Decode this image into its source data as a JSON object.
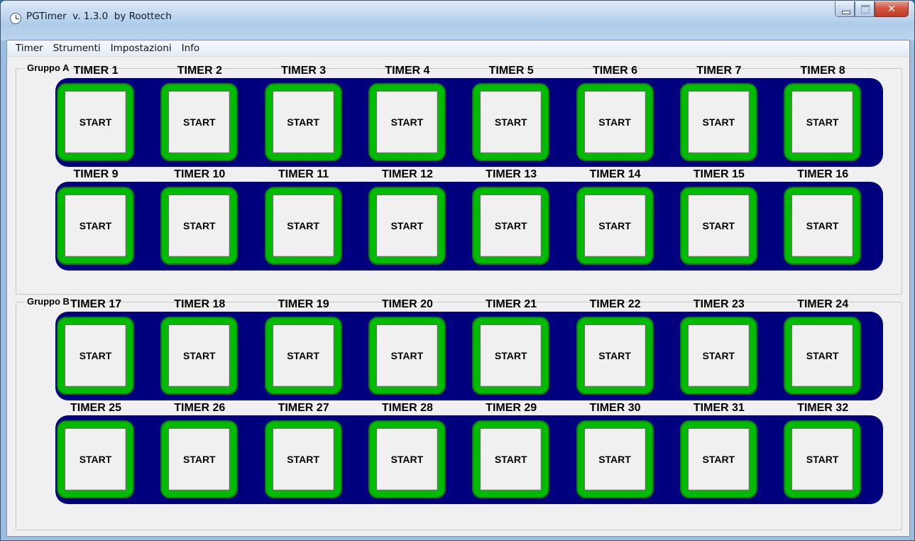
{
  "window": {
    "title": "PGTimer  v. 1.3.0  by Roottech"
  },
  "menu": {
    "items": [
      "Timer",
      "Strumenti",
      "Impostazioni",
      "Info"
    ]
  },
  "groups": [
    {
      "legend": "Gruppo A"
    },
    {
      "legend": "Gruppo B"
    }
  ],
  "timers": [
    {
      "label": "TIMER  1",
      "button": "START"
    },
    {
      "label": "TIMER  2",
      "button": "START"
    },
    {
      "label": "TIMER  3",
      "button": "START"
    },
    {
      "label": "TIMER  4",
      "button": "START"
    },
    {
      "label": "TIMER  5",
      "button": "START"
    },
    {
      "label": "TIMER  6",
      "button": "START"
    },
    {
      "label": "TIMER  7",
      "button": "START"
    },
    {
      "label": "TIMER  8",
      "button": "START"
    },
    {
      "label": "TIMER  9",
      "button": "START"
    },
    {
      "label": "TIMER 10",
      "button": "START"
    },
    {
      "label": "TIMER 11",
      "button": "START"
    },
    {
      "label": "TIMER 12",
      "button": "START"
    },
    {
      "label": "TIMER 13",
      "button": "START"
    },
    {
      "label": "TIMER 14",
      "button": "START"
    },
    {
      "label": "TIMER 15",
      "button": "START"
    },
    {
      "label": "TIMER 16",
      "button": "START"
    },
    {
      "label": "TIMER 17",
      "button": "START"
    },
    {
      "label": "TIMER 18",
      "button": "START"
    },
    {
      "label": "TIMER 19",
      "button": "START"
    },
    {
      "label": "TIMER 20",
      "button": "START"
    },
    {
      "label": "TIMER 21",
      "button": "START"
    },
    {
      "label": "TIMER 22",
      "button": "START"
    },
    {
      "label": "TIMER 23",
      "button": "START"
    },
    {
      "label": "TIMER 24",
      "button": "START"
    },
    {
      "label": "TIMER 25",
      "button": "START"
    },
    {
      "label": "TIMER 26",
      "button": "START"
    },
    {
      "label": "TIMER 27",
      "button": "START"
    },
    {
      "label": "TIMER 28",
      "button": "START"
    },
    {
      "label": "TIMER 29",
      "button": "START"
    },
    {
      "label": "TIMER 30",
      "button": "START"
    },
    {
      "label": "TIMER 31",
      "button": "START"
    },
    {
      "label": "TIMER 32",
      "button": "START"
    }
  ],
  "colors": {
    "panel": "#00007f",
    "timer_frame": "#00bb00",
    "client_background": "#f0f0f0"
  },
  "icons": {
    "app": "clock-icon",
    "minimize": "minimize-icon",
    "maximize": "maximize-icon",
    "close": "close-icon"
  }
}
